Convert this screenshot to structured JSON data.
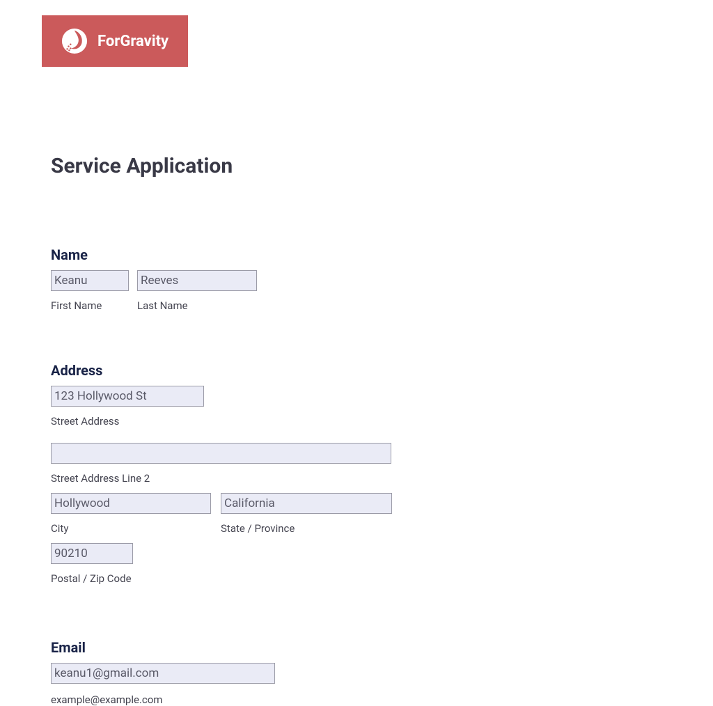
{
  "brand": {
    "name": "ForGravity",
    "bg_color": "#cb5a5b"
  },
  "page": {
    "title": "Service Application"
  },
  "name": {
    "label": "Name",
    "first": {
      "value": "Keanu",
      "sublabel": "First Name"
    },
    "last": {
      "value": "Reeves",
      "sublabel": "Last Name"
    }
  },
  "address": {
    "label": "Address",
    "street1": {
      "value": "123 Hollywood St",
      "sublabel": "Street Address"
    },
    "street2": {
      "value": "",
      "sublabel": "Street Address Line 2"
    },
    "city": {
      "value": "Hollywood",
      "sublabel": "City"
    },
    "state": {
      "value": "California",
      "sublabel": "State / Province"
    },
    "postal": {
      "value": "90210",
      "sublabel": "Postal / Zip Code"
    }
  },
  "email": {
    "label": "Email",
    "value": "keanu1@gmail.com",
    "example": "example@example.com"
  }
}
